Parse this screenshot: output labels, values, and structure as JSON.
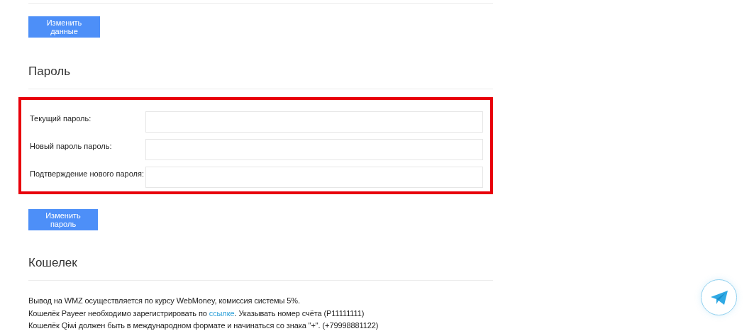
{
  "profile": {
    "save_button": "Изменить данные"
  },
  "password": {
    "heading": "Пароль",
    "highlighted": true,
    "fields": [
      {
        "label": "Текущий пароль:"
      },
      {
        "label": "Новый пароль пароль:"
      },
      {
        "label": "Подтверждение нового пароля:"
      }
    ],
    "submit_button": "Изменить пароль"
  },
  "wallet": {
    "heading": "Кошелек",
    "lines": [
      {
        "text": "Вывод на WMZ осуществляется по курсу WebMoney, комиссия системы 5%."
      },
      {
        "text": "Кошелёк Payeer необходимо зарегистрировать по ",
        "link": "ссылке",
        "text_after": ". Указывать номер счёта (P11111111)"
      },
      {
        "text": "Кошелёк Qiwi должен быть в международном формате и начинаться со знака \"+\". (+79998881122)"
      }
    ]
  }
}
